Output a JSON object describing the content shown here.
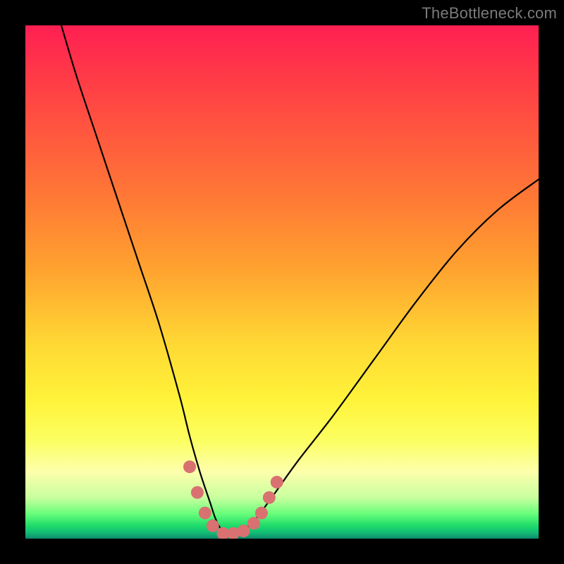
{
  "watermark": {
    "text": "TheBottleneck.com"
  },
  "chart_data": {
    "type": "line",
    "title": "",
    "xlabel": "",
    "ylabel": "",
    "xlim": [
      0,
      100
    ],
    "ylim": [
      0,
      100
    ],
    "grid": false,
    "legend": false,
    "background": "rainbow-gradient",
    "series": [
      {
        "name": "bottleneck-curve",
        "color": "#000000",
        "x": [
          7,
          10,
          14,
          18,
          22,
          26,
          30,
          32,
          34,
          36,
          37,
          38,
          39,
          40,
          41,
          43,
          45,
          48,
          53,
          60,
          68,
          76,
          84,
          92,
          100
        ],
        "y": [
          100,
          90,
          78,
          66,
          54,
          42,
          28,
          20,
          13,
          7,
          4,
          2,
          1,
          1,
          1,
          2,
          4,
          8,
          15,
          24,
          35,
          46,
          56,
          64,
          70
        ]
      }
    ],
    "markers": {
      "name": "highlight-points",
      "color": "#d97171",
      "points": [
        {
          "x": 32,
          "y": 14
        },
        {
          "x": 33.5,
          "y": 9
        },
        {
          "x": 35,
          "y": 5
        },
        {
          "x": 36.5,
          "y": 2.5
        },
        {
          "x": 38.5,
          "y": 1
        },
        {
          "x": 40.5,
          "y": 1
        },
        {
          "x": 42.5,
          "y": 1.5
        },
        {
          "x": 44.5,
          "y": 3
        },
        {
          "x": 46,
          "y": 5
        },
        {
          "x": 47.5,
          "y": 8
        },
        {
          "x": 49,
          "y": 11
        }
      ]
    }
  }
}
